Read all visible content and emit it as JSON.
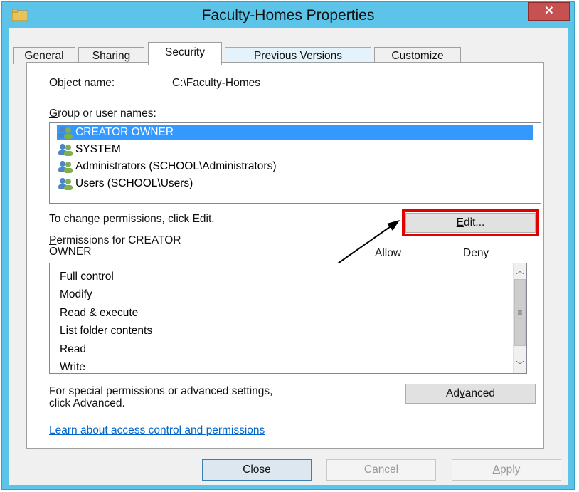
{
  "window": {
    "title": "Faculty-Homes Properties",
    "close_label": "✕"
  },
  "tabs": [
    {
      "label": "General"
    },
    {
      "label": "Sharing"
    },
    {
      "label": "Security"
    },
    {
      "label": "Previous Versions"
    },
    {
      "label": "Customize"
    }
  ],
  "object": {
    "label": "Object name:",
    "value": "C:\\Faculty-Homes"
  },
  "group_label_first": "G",
  "group_label_rest": "roup or user names:",
  "users": [
    "CREATOR OWNER",
    "SYSTEM",
    "Administrators (SCHOOL\\Administrators)",
    "Users (SCHOOL\\Users)"
  ],
  "change_perm_text": "To change permissions, click Edit.",
  "edit_button": {
    "first": "E",
    "rest": "dit..."
  },
  "permissions_for": {
    "first": "P",
    "line1_rest": "ermissions for CREATOR",
    "line2": "OWNER"
  },
  "perm_columns": {
    "allow": "Allow",
    "deny": "Deny"
  },
  "permissions": [
    "Full control",
    "Modify",
    "Read & execute",
    "List folder contents",
    "Read",
    "Write"
  ],
  "scrollbar": {
    "up": "︿",
    "thumb": "≡",
    "down": "﹀"
  },
  "special_text": {
    "line1": "For special permissions or advanced settings,",
    "line2": "click Advanced."
  },
  "advanced_button": {
    "pre": "Ad",
    "u": "v",
    "post": "anced"
  },
  "learn_link": "Learn about access control and permissions",
  "footer": {
    "close": "Close",
    "cancel": "Cancel",
    "apply_first": "A",
    "apply_rest": "pply"
  },
  "colors": {
    "title_bar": "#5cc4e8",
    "selection": "#3399ff",
    "highlight": "#e00000",
    "link": "#0066cc"
  }
}
